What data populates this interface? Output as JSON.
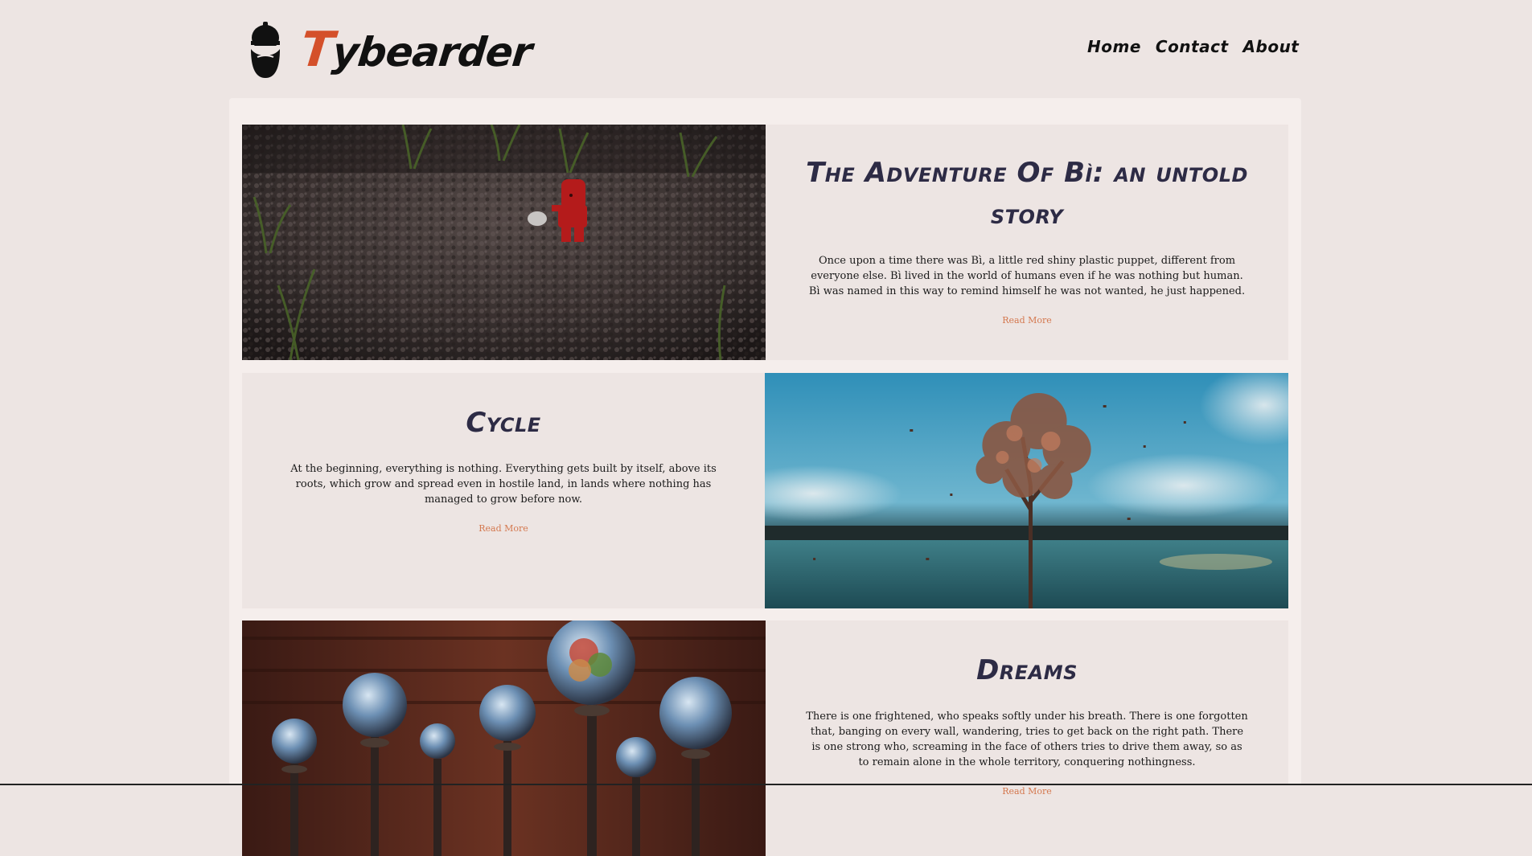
{
  "brand": {
    "first_letter": "T",
    "rest": "ybearder"
  },
  "nav": [
    {
      "label": "Home"
    },
    {
      "label": "Contact"
    },
    {
      "label": "About"
    }
  ],
  "posts": [
    {
      "title": "The Adventure Of Bì: an untold story",
      "excerpt": "Once upon a time there was Bì, a little red shiny plastic puppet, different from everyone else. Bì lived in the world of humans even if he was nothing but human. Bì was named in this way to remind himself he was not wanted, he just happened.",
      "link": "Read More",
      "image": "red-puppet-on-soil"
    },
    {
      "title": "Cycle",
      "excerpt": "At the beginning, everything is nothing. Everything gets built by itself, above its roots, which grow and spread even in hostile land, in lands where nothing has managed to grow before now.",
      "link": "Read More",
      "image": "tree-in-water"
    },
    {
      "title": "Dreams",
      "excerpt": "There is one frightened, who speaks softly under his breath. There is one forgotten that, banging on every wall, wandering, tries to get back on the right path. There is one strong who, screaming in the face of others tries to drive them away, so as to remain alone in the whole territory, conquering nothingness.",
      "link": "Read More",
      "image": "glass-spheres"
    }
  ],
  "colors": {
    "background": "#ede5e3",
    "panel": "#f5eeec",
    "accent": "#d4502a",
    "title": "#2d2b45",
    "link": "#d4784f"
  }
}
